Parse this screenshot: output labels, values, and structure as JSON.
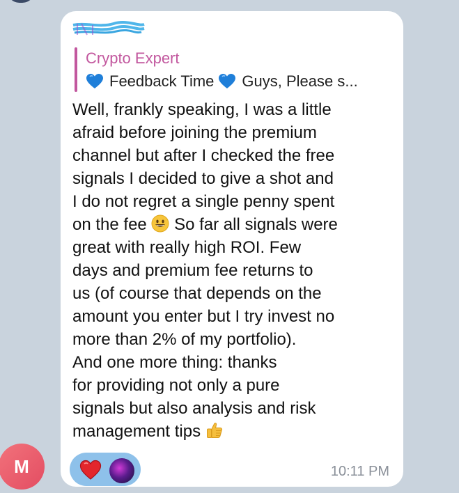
{
  "reply": {
    "title": "Crypto Expert",
    "text_a": "Feedback Time",
    "text_b": "Guys, Please s..."
  },
  "message": {
    "lines": [
      "Well, frankly speaking, I was a little",
      "afraid before joining the premium",
      "channel but after I checked the free",
      "signals I decided to give a shot and",
      "I do not regret a single penny spent",
      "on the fee",
      "So far all signals were",
      "great with really high ROI. Few",
      "days and premium fee returns to",
      "us (of course that depends on the",
      "amount you enter but I try invest no",
      "more than 2% of my portfolio).",
      "And one more thing: thanks",
      "for providing not only a pure",
      "signals but also analysis and risk",
      "management tips"
    ]
  },
  "reactions": {
    "heart_icon": "red-heart-icon",
    "user_icon": "reactor-avatar"
  },
  "timestamp": "10:11 PM",
  "avatar": {
    "initial": "M"
  },
  "colors": {
    "background": "#c9d3dd",
    "bubble": "#ffffff",
    "reply_accent": "#c2579e",
    "reactions_pill": "#8ec1ea",
    "avatar": "#e34d62",
    "timestamp": "#8a9099"
  }
}
